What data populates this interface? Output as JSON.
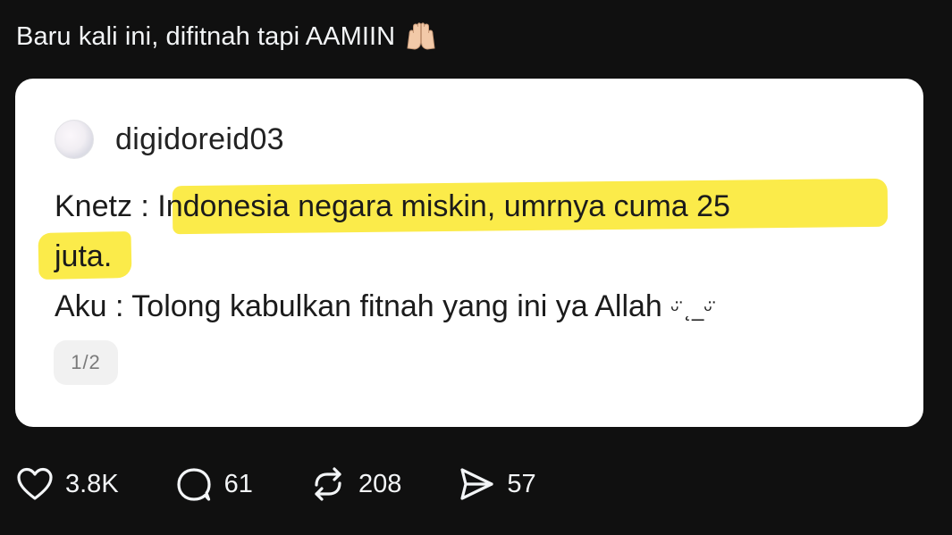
{
  "post": {
    "caption": "Baru kali ini, difitnah tapi AAMIIN",
    "caption_emoji": "raising-hands-icon"
  },
  "card": {
    "username": "digidoreid03",
    "line1_prefix": "Knetz : ",
    "line1_highlight": "Indonesia negara miskin, umrnya cuma 25",
    "line2_highlight": "juta.",
    "line3": "Aku : Tolong kabulkan fitnah yang ini ya Allah",
    "line3_kaomoji": "ᵕ̈ ˛_ᵕ̈",
    "page_indicator": "1/2",
    "highlight_color": "#fbeb4a"
  },
  "actions": {
    "likes": "3.8K",
    "replies": "61",
    "reposts": "208",
    "shares": "57"
  }
}
